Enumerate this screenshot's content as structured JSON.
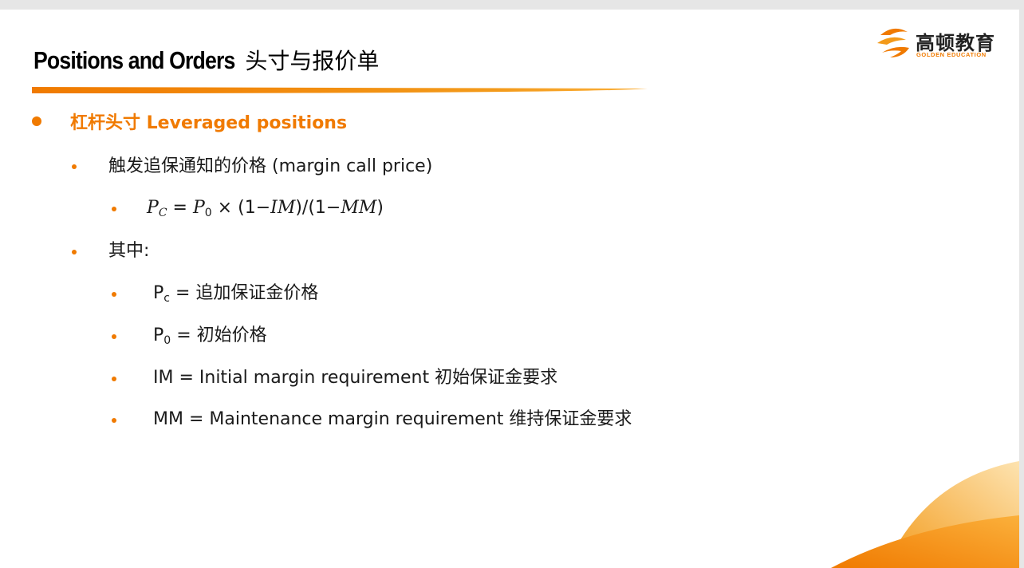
{
  "title": {
    "en": "Positions and Orders",
    "cn": "头寸与报价单"
  },
  "logo": {
    "cn": "高顿教育",
    "en": "GOLDEN EDUCATION"
  },
  "colors": {
    "accent": "#f07a00",
    "accent_light": "#fbb03b"
  },
  "heading": "杠杆头寸 Leveraged positions",
  "item1": "触发追保通知的价格 (margin call price)",
  "formula": {
    "lhs": "P",
    "lhs_sub": "C",
    "eq": " = ",
    "p": "P",
    "p_sub": "0",
    "rest1": " × (1−",
    "im": "IM",
    "rest2": ")/(1−",
    "mm": "MM",
    "rest3": ")"
  },
  "item2": "其中:",
  "defs": [
    {
      "sym": "P",
      "sub": "c",
      "text": " = 追加保证金价格"
    },
    {
      "sym": "P",
      "sub": "0",
      "text": " = 初始价格"
    },
    {
      "sym": "",
      "sub": "",
      "text": "IM = Initial margin requirement 初始保证金要求"
    },
    {
      "sym": "",
      "sub": "",
      "text": "MM = Maintenance margin requirement 维持保证金要求"
    }
  ]
}
